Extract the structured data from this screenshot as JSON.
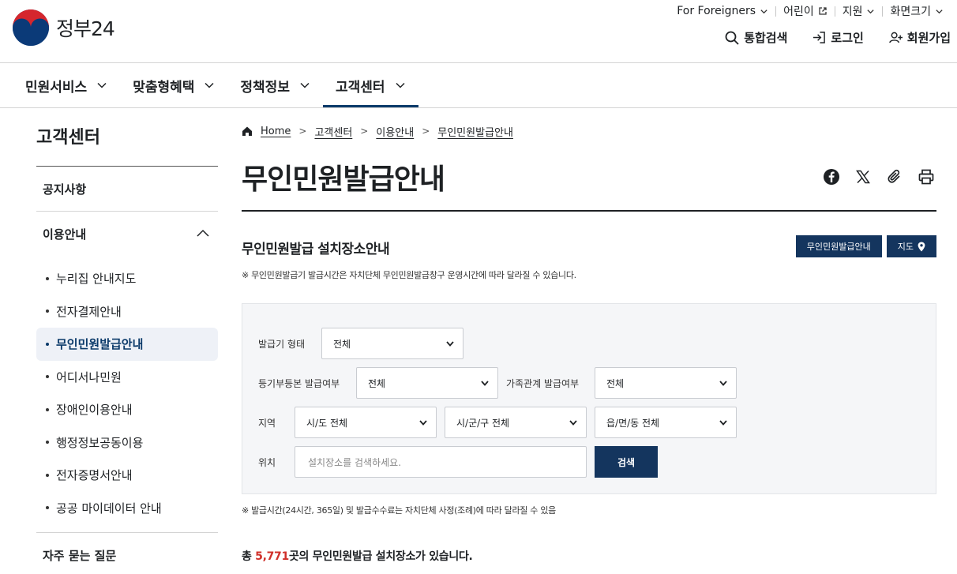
{
  "header": {
    "logo_text": "정부",
    "logo_num": "24",
    "utility": {
      "foreigners": "For Foreigners",
      "kids": "어린이",
      "support": "지원",
      "screen_size": "화면크기"
    },
    "actions": {
      "search": "통합검색",
      "login": "로그인",
      "signup": "회원가입"
    },
    "menu": [
      {
        "label": "민원서비스"
      },
      {
        "label": "맞춤형혜택"
      },
      {
        "label": "정책정보"
      },
      {
        "label": "고객센터"
      }
    ]
  },
  "sidebar": {
    "title": "고객센터",
    "sections": [
      {
        "label": "공지사항"
      },
      {
        "label": "이용안내"
      },
      {
        "label": "자주 묻는 질문"
      }
    ],
    "sub_items": [
      {
        "label": "누리집 안내지도"
      },
      {
        "label": "전자결제안내"
      },
      {
        "label": "무인민원발급안내"
      },
      {
        "label": "어디서나민원"
      },
      {
        "label": "장애인이용안내"
      },
      {
        "label": "행정정보공동이용"
      },
      {
        "label": "전자증명서안내"
      },
      {
        "label": "공공 마이데이터 안내"
      }
    ]
  },
  "breadcrumb": [
    "Home",
    "고객센터",
    "이용안내",
    "무인민원발급안내"
  ],
  "page_title": "무인민원발급안내",
  "section": {
    "title": "무인민원발급 설치장소안내",
    "btn_kiosk": "무인민원발급안내",
    "btn_map": "지도",
    "note": "※ 무인민원발급기 발급시간은 자치단체 무인민원발급창구 운영시간에 따라 달라질 수 있습니다."
  },
  "search": {
    "kiosk_type_label": "발급기 형태",
    "kiosk_type_value": "전체",
    "register_label": "등기부등본 발급여부",
    "register_value": "전체",
    "family_label": "가족관계 발급여부",
    "family_value": "전체",
    "region_label": "지역",
    "sido_value": "시/도 전체",
    "sigungu_value": "시/군/구 전체",
    "dong_value": "읍/면/동 전체",
    "location_label": "위치",
    "location_placeholder": "설치장소를 검색하세요.",
    "search_button": "검색"
  },
  "note2": "※ 발급시간(24시간, 365일) 및 발급수수료는 자치단체 사정(조례)에 따라 달라질 수 있음",
  "total": {
    "prefix": "총 ",
    "count": "5,771",
    "suffix": "곳의 무인민원발급 설치장소가 있습니다."
  }
}
